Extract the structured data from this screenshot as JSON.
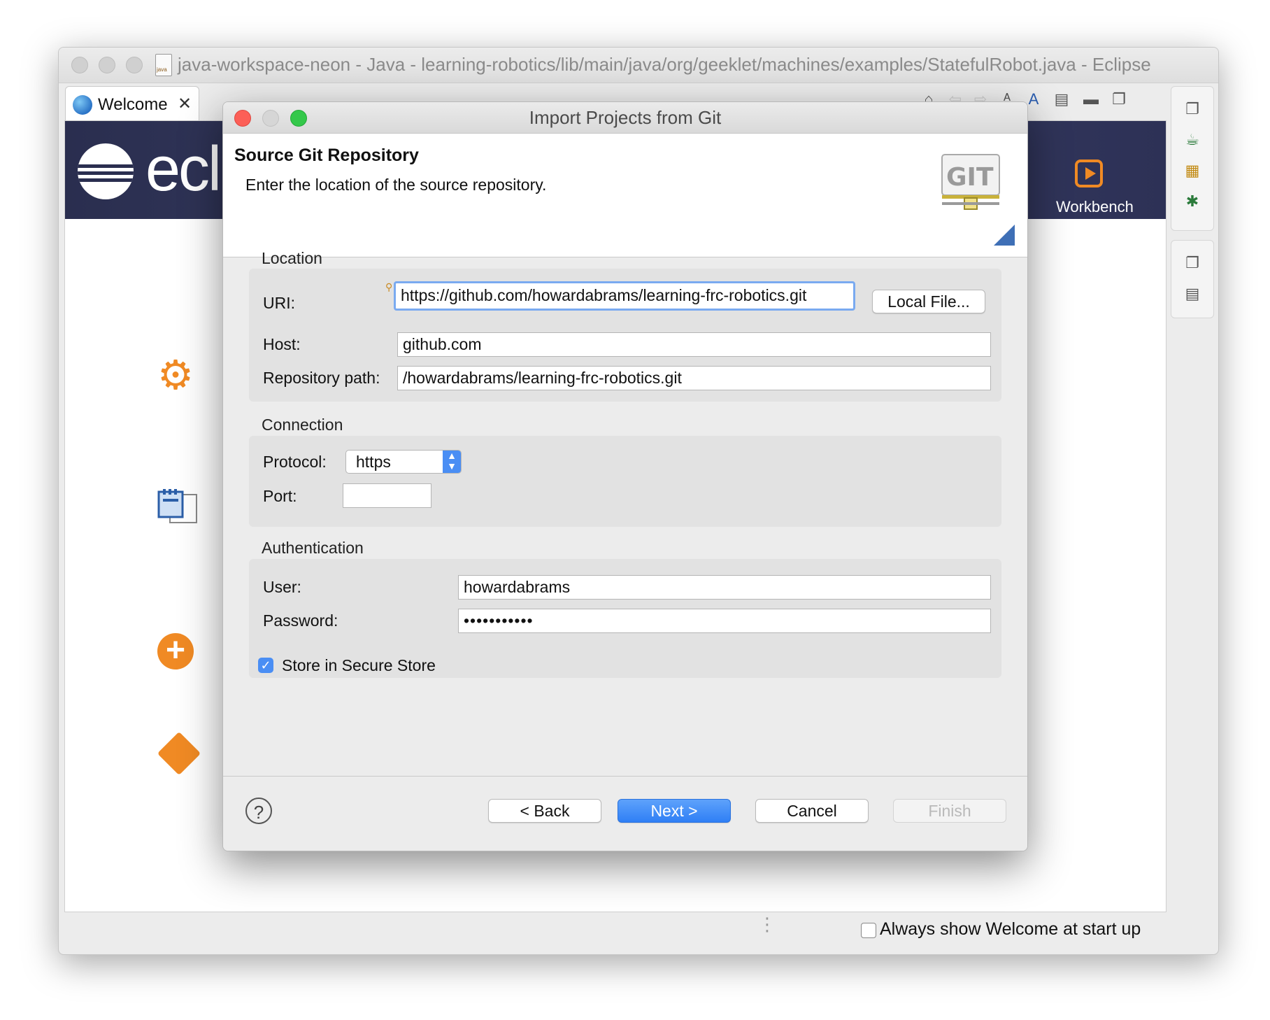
{
  "eclipse_window": {
    "title": "java-workspace-neon - Java - learning-robotics/lib/main/java/org/geeklet/machines/examples/StatefulRobot.java - Eclipse"
  },
  "welcome": {
    "tab_label": "Welcome",
    "brand_text": "ecl",
    "workbench_label": "Workbench",
    "always_show_label": "Always show Welcome at start up",
    "always_show_checked": false
  },
  "dialog": {
    "title": "Import Projects from Git",
    "header_title": "Source Git Repository",
    "header_description": "Enter the location of the source repository.",
    "location": {
      "group_label": "Location",
      "uri_label": "URI:",
      "uri_value": "https://github.com/howardabrams/learning-frc-robotics.git",
      "local_file_button": "Local File...",
      "host_label": "Host:",
      "host_value": "github.com",
      "repo_path_label": "Repository path:",
      "repo_path_value": "/howardabrams/learning-frc-robotics.git"
    },
    "connection": {
      "group_label": "Connection",
      "protocol_label": "Protocol:",
      "protocol_value": "https",
      "port_label": "Port:",
      "port_value": ""
    },
    "authentication": {
      "group_label": "Authentication",
      "user_label": "User:",
      "user_value": "howardabrams",
      "password_label": "Password:",
      "password_value": "•••••••••••",
      "store_label": "Store in Secure Store",
      "store_checked": true
    },
    "footer": {
      "help_symbol": "?",
      "back_label": "< Back",
      "next_label": "Next >",
      "cancel_label": "Cancel",
      "finish_label": "Finish"
    }
  },
  "colors": {
    "accent_blue": "#4a8ef4",
    "eclipse_orange": "#f08a24",
    "banner_navy": "#2a2e4f"
  }
}
